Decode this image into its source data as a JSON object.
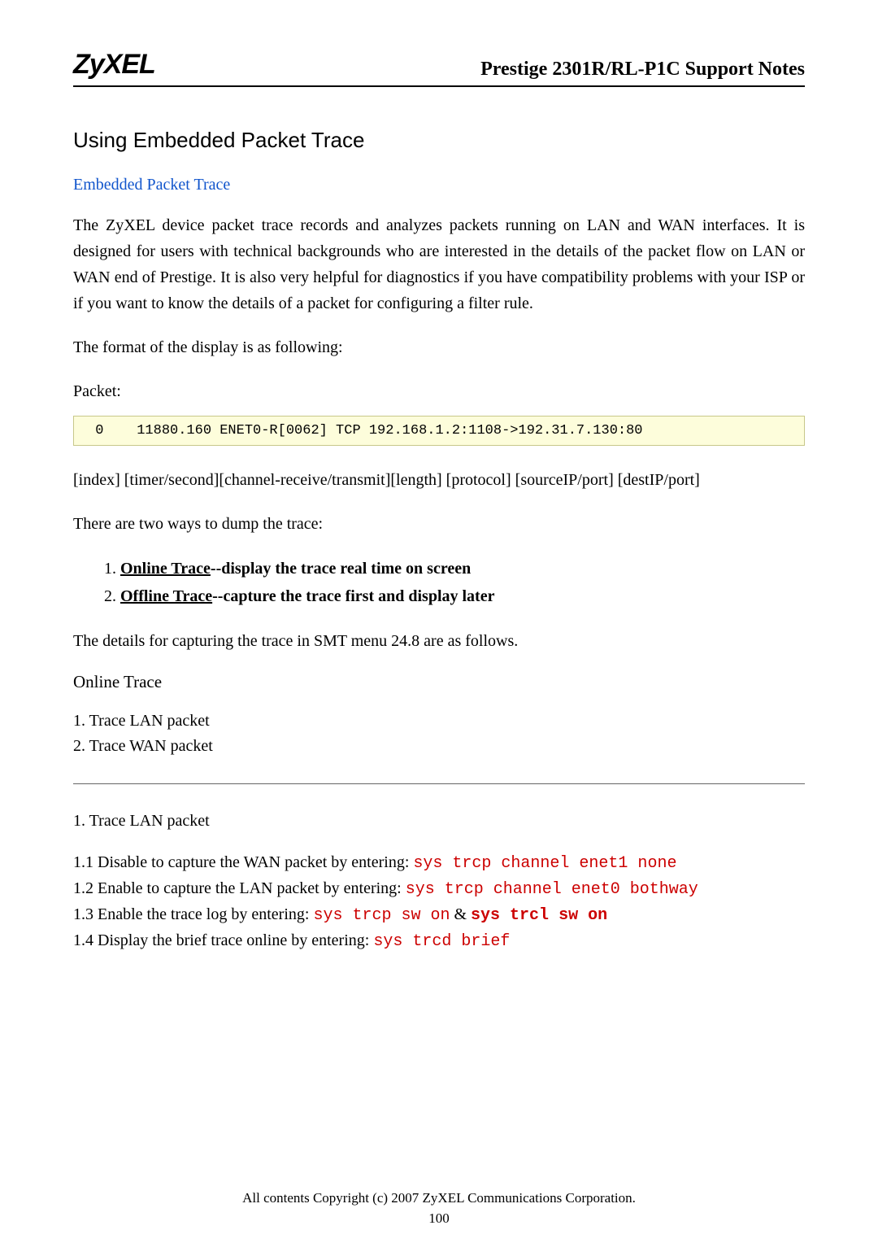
{
  "header": {
    "logo": "ZyXEL",
    "doc_title": "Prestige 2301R/RL-P1C Support Notes"
  },
  "section_heading": "Using Embedded Packet Trace",
  "subhead_blue": "Embedded Packet Trace",
  "para1": "The ZyXEL device packet trace records and analyzes packets running on LAN and WAN interfaces. It is designed for users with technical backgrounds who are interested in the details of the packet flow on LAN or WAN end of Prestige. It is also very helpful for diagnostics if you have compatibility problems with your ISP or if you want to know the details of a packet for configuring a filter rule.",
  "para2": "The format of the display is as following:",
  "packet_label": "Packet:",
  "code_sample": " 0    11880.160 ENET0-R[0062] TCP 192.168.1.2:1108->192.31.7.130:80",
  "schema_line": "[index] [timer/second][channel-receive/transmit][length]  [protocol] [sourceIP/port] [destIP/port]",
  "two_ways_line": "There are two ways to dump the trace:",
  "list_items": [
    {
      "link": "Online Trace",
      "rest": "--display the trace real time on screen"
    },
    {
      "link": "Offline Trace",
      "rest": "--capture the trace first and display later"
    }
  ],
  "details_line": "The details for capturing the trace in SMT menu 24.8 are as follows.",
  "online_trace_heading": "Online Trace",
  "trace_lan_line": "1. Trace LAN packet",
  "trace_wan_line": "2. Trace WAN packet",
  "trace_lan_heading": "1. Trace LAN packet",
  "steps": {
    "s11_prefix": "1.1 Disable to capture the WAN packet by entering: ",
    "s11_cmd": "sys trcp channel enet1 none",
    "s12_prefix": "1.2 Enable to capture the LAN packet by entering: ",
    "s12_cmd": "sys trcp channel enet0 bothway",
    "s13_prefix": "1.3 Enable the trace log by entering: ",
    "s13_cmd1": "sys trcp sw on",
    "s13_amp": " & ",
    "s13_cmd2": "sys trcl sw on",
    "s14_prefix": "1.4 Display the brief trace online by entering: ",
    "s14_cmd": "sys trcd brief"
  },
  "footer": "All contents Copyright (c) 2007 ZyXEL Communications Corporation.",
  "page_number": "100"
}
